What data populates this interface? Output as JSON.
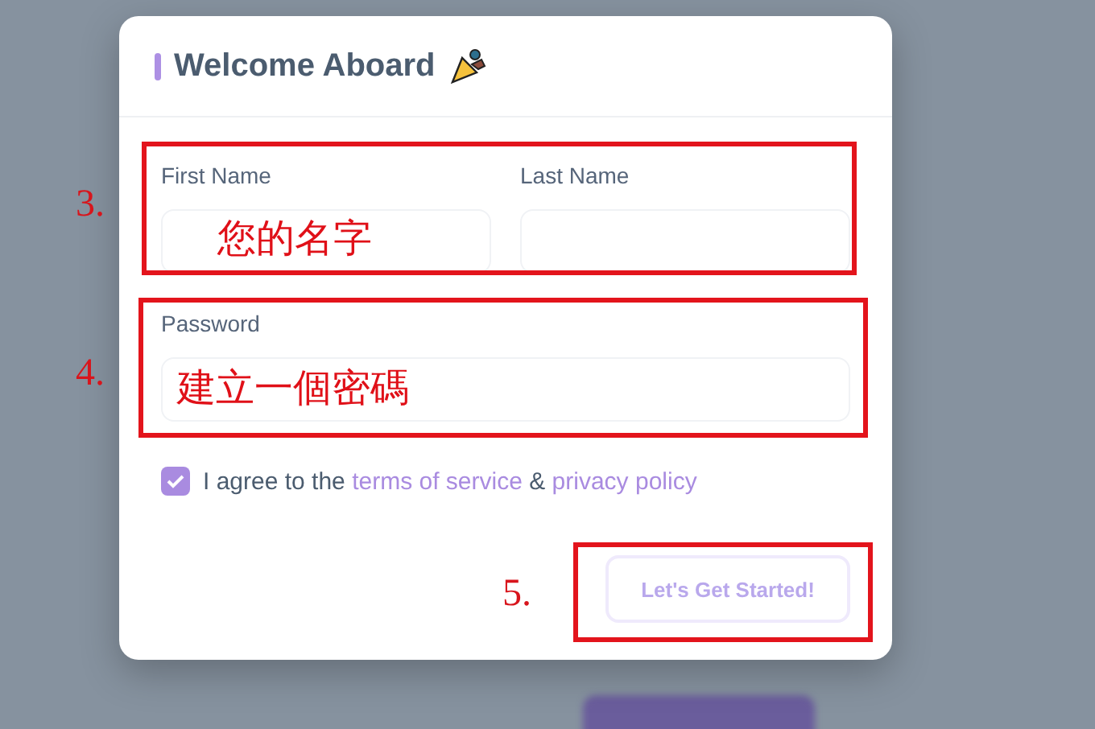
{
  "dialog": {
    "title": "Welcome Aboard",
    "fields": [
      {
        "label": "First Name"
      },
      {
        "label": "Last Name"
      }
    ],
    "password": {
      "label": "Password"
    },
    "agreement": {
      "checked": true,
      "text_before": "I agree to the",
      "link_1": "terms of service",
      "joiner": "&",
      "link_2": "privacy policy"
    },
    "submit": {
      "label": "Let's Get Started!",
      "disabled": true
    }
  },
  "annotations": [
    {
      "number": "3.",
      "note": "您的名字"
    },
    {
      "number": "4.",
      "note": "建立一個密碼"
    },
    {
      "number": "5."
    }
  ]
}
